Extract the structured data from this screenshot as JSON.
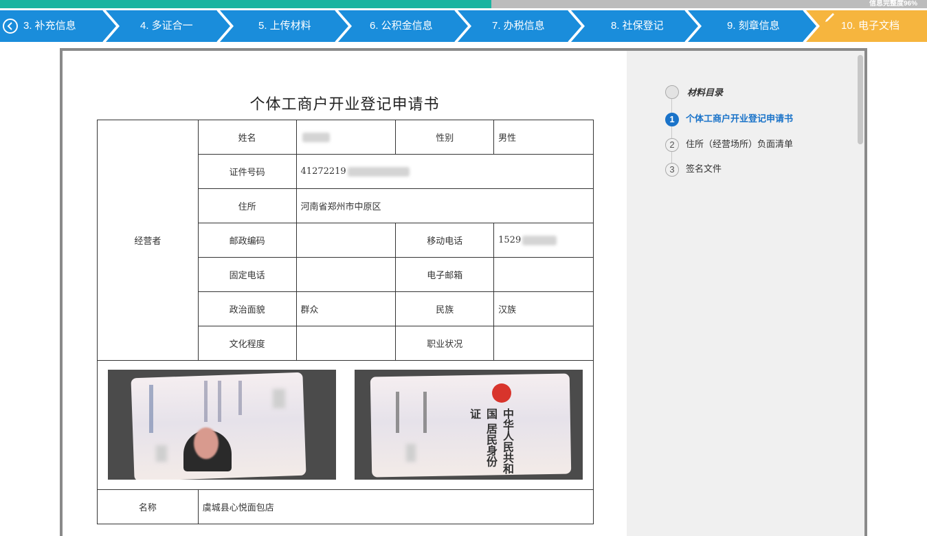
{
  "progress": {
    "fraction": 0.53,
    "text": "信息完整度96%"
  },
  "steps": [
    {
      "label": "3. 补充信息"
    },
    {
      "label": "4. 多证合一"
    },
    {
      "label": "5. 上传材料"
    },
    {
      "label": "6. 公积金信息"
    },
    {
      "label": "7. 办税信息"
    },
    {
      "label": "8. 社保登记"
    },
    {
      "label": "9. 刻章信息"
    },
    {
      "label": "10. 电子文档"
    }
  ],
  "colors": {
    "step_bg": "#1a8ddb",
    "step_active": "#f6b53e",
    "progress": "#19b4a0",
    "toc_active": "#1a73c9"
  },
  "document": {
    "title": "个体工商户开业登记申请书",
    "operator_label": "经营者",
    "fields": {
      "name_label": "姓名",
      "gender_label": "性别",
      "gender_value": "男性",
      "id_label": "证件号码",
      "id_value": "41272219",
      "address_label": "住所",
      "address_value": "河南省郑州市中原区",
      "postal_label": "邮政编码",
      "mobile_label": "移动电话",
      "mobile_value": "1529",
      "phone_label": "固定电话",
      "email_label": "电子邮箱",
      "political_label": "政治面貌",
      "political_value": "群众",
      "ethnic_label": "民族",
      "ethnic_value": "汉族",
      "education_label": "文化程度",
      "occupation_label": "职业状况",
      "company_label": "名称",
      "company_value": "虞城县心悦面包店"
    },
    "id_card_back_text": "中华人民共和国 居民身份证"
  },
  "toc": {
    "title": "材料目录",
    "items": [
      {
        "num": "1",
        "label": "个体工商户开业登记申请书",
        "active": true
      },
      {
        "num": "2",
        "label": "住所（经营场所）负面清单",
        "active": false
      },
      {
        "num": "3",
        "label": "签名文件",
        "active": false
      }
    ]
  }
}
